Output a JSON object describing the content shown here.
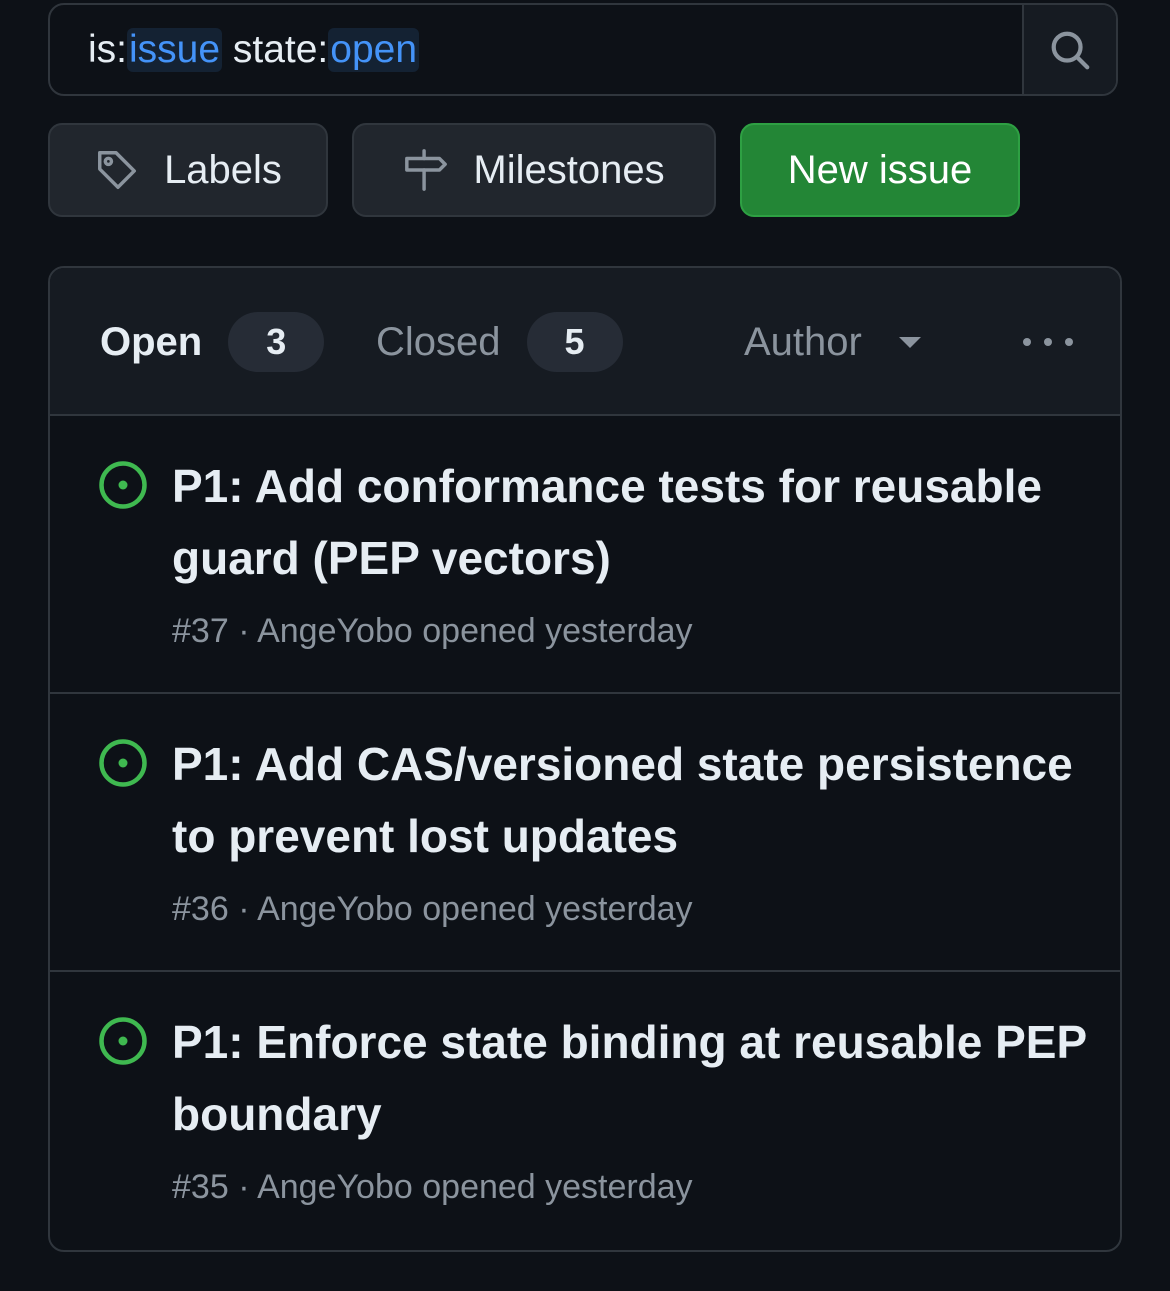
{
  "search": {
    "tokens": [
      {
        "text": "is:",
        "highlight": false
      },
      {
        "text": "issue",
        "highlight": true
      },
      {
        "text": " state:",
        "highlight": false
      },
      {
        "text": "open",
        "highlight": true
      }
    ],
    "button_icon": "search-icon"
  },
  "actions": {
    "labels_label": "Labels",
    "labels_icon": "tag-icon",
    "milestones_label": "Milestones",
    "milestones_icon": "milestone-icon",
    "new_issue_label": "New issue"
  },
  "filters": {
    "open_label": "Open",
    "open_count": "3",
    "closed_label": "Closed",
    "closed_count": "5",
    "author_label": "Author"
  },
  "issues": [
    {
      "title": "P1: Add conformance tests for reusable guard (PEP vectors)",
      "number": "#37",
      "author": "AngeYobo",
      "status_text": "opened yesterday",
      "state": "open"
    },
    {
      "title": "P1: Add CAS/versioned state persistence to prevent lost updates",
      "number": "#36",
      "author": "AngeYobo",
      "status_text": "opened yesterday",
      "state": "open"
    },
    {
      "title": "P1: Enforce state binding at reusable PEP boundary",
      "number": "#35",
      "author": "AngeYobo",
      "status_text": "opened yesterday",
      "state": "open"
    }
  ],
  "colors": {
    "background": "#0d1117",
    "surface": "#161b22",
    "border": "#30363d",
    "accent_blue": "#4493f8",
    "open_green": "#3fb950",
    "primary_button": "#238636",
    "muted_text": "#8b949e"
  }
}
